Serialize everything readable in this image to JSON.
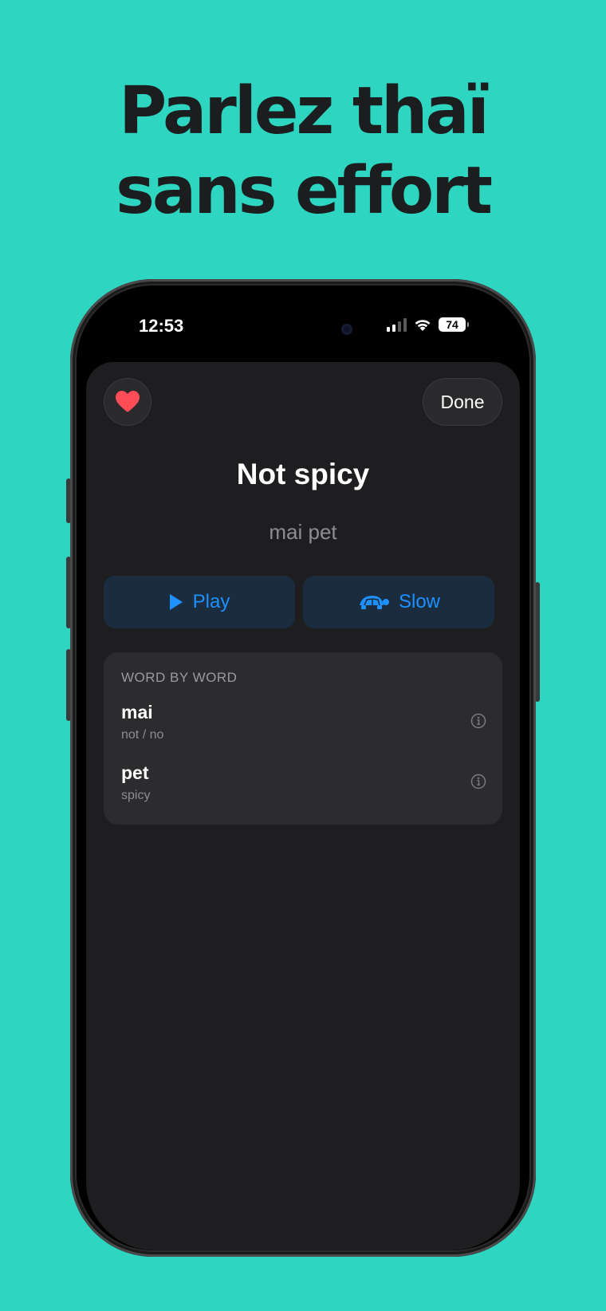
{
  "headline": {
    "line1": "Parlez thaï",
    "line2": "sans effort"
  },
  "status_bar": {
    "time": "12:53",
    "battery": "74"
  },
  "sheet": {
    "done_label": "Done",
    "phrase": "Not spicy",
    "transliteration": "mai pet",
    "play_label": "Play",
    "slow_label": "Slow",
    "word_by_word": {
      "header": "WORD BY WORD",
      "words": [
        {
          "word": "mai",
          "meaning": "not / no"
        },
        {
          "word": "pet",
          "meaning": "spicy"
        }
      ]
    }
  },
  "colors": {
    "background": "#2ed5c0",
    "accent": "#1e90ff",
    "heart": "#ff4d57",
    "sheet": "#1e1e20"
  },
  "icons": [
    "heart-icon",
    "play-icon",
    "turtle-icon",
    "info-icon",
    "wifi-icon",
    "signal-icon",
    "battery-icon"
  ]
}
